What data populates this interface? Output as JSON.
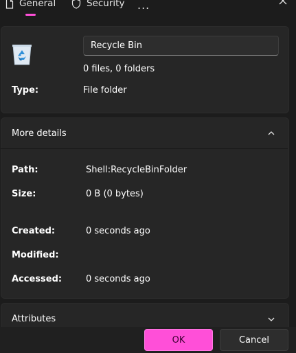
{
  "tabs": [
    {
      "label": "General",
      "active": true
    },
    {
      "label": "Security",
      "active": false
    }
  ],
  "tabs_more": "...",
  "accent_color": "#ff4fd8",
  "header": {
    "icon": "recycle-bin-icon",
    "name_value": "Recycle Bin",
    "summary": "0 files, 0 folders",
    "type_label": "Type:",
    "type_value": "File folder"
  },
  "more_details": {
    "title": "More details",
    "expanded": true,
    "rows": [
      {
        "label": "Path:",
        "value": "Shell:RecycleBinFolder"
      },
      {
        "label": "Size:",
        "value": "0 B (0 bytes)"
      },
      {
        "label": "Created:",
        "value": "0 seconds ago"
      },
      {
        "label": "Modified:",
        "value": ""
      },
      {
        "label": "Accessed:",
        "value": "0 seconds ago"
      }
    ]
  },
  "attributes": {
    "title": "Attributes",
    "expanded": false
  },
  "buttons": {
    "ok": "OK",
    "cancel": "Cancel"
  }
}
